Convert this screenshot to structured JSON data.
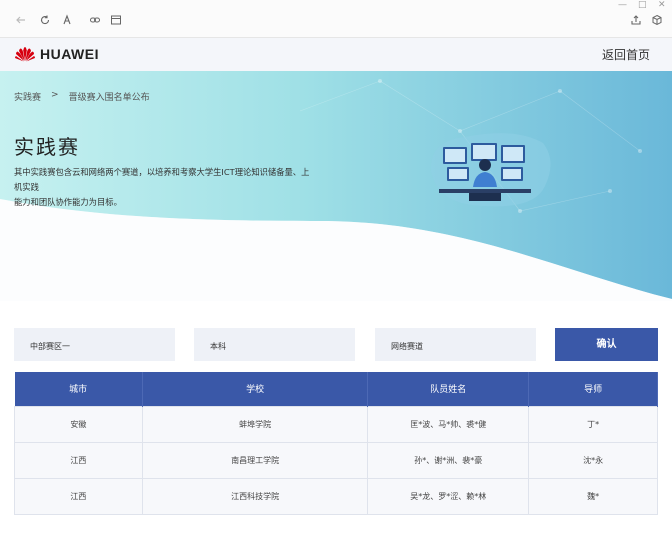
{
  "browser": {
    "icons": [
      "back-icon",
      "refresh-icon",
      "reader-mode-icon",
      "link-icon",
      "window-icon",
      "share-icon",
      "cube-icon"
    ],
    "window_controls": [
      "—",
      "□",
      "✕"
    ]
  },
  "header": {
    "brand": "HUAWEI",
    "back_home": "返回首页"
  },
  "hero": {
    "breadcrumb": [
      "实践赛",
      ">",
      "晋级赛入围名单公布"
    ],
    "title": "实践赛",
    "description_line1": "其中实践赛包含云和网络两个赛道，以培养和考察大学生ICT理论知识储备量、上机实践",
    "description_line2": "能力和团队协作能力为目标。"
  },
  "filters": {
    "region": "中部赛区一",
    "level": "本科",
    "track": "网络赛道",
    "confirm": "确认"
  },
  "table": {
    "headers": [
      "城市",
      "学校",
      "队员姓名",
      "导师"
    ],
    "rows": [
      [
        "安徽",
        "蚌埠学院",
        "匡*波、马*帅、裘*健",
        "丁*"
      ],
      [
        "江西",
        "南昌理工学院",
        "孙*、谢*洲、裴*豪",
        "沈*永"
      ],
      [
        "江西",
        "江西科技学院",
        "吴*龙、罗*涩、赖*林",
        "魏*"
      ]
    ]
  },
  "colors": {
    "accent": "#3a58a8",
    "hero_light": "#bfeef0",
    "hero_dark": "#6ec0d8"
  }
}
